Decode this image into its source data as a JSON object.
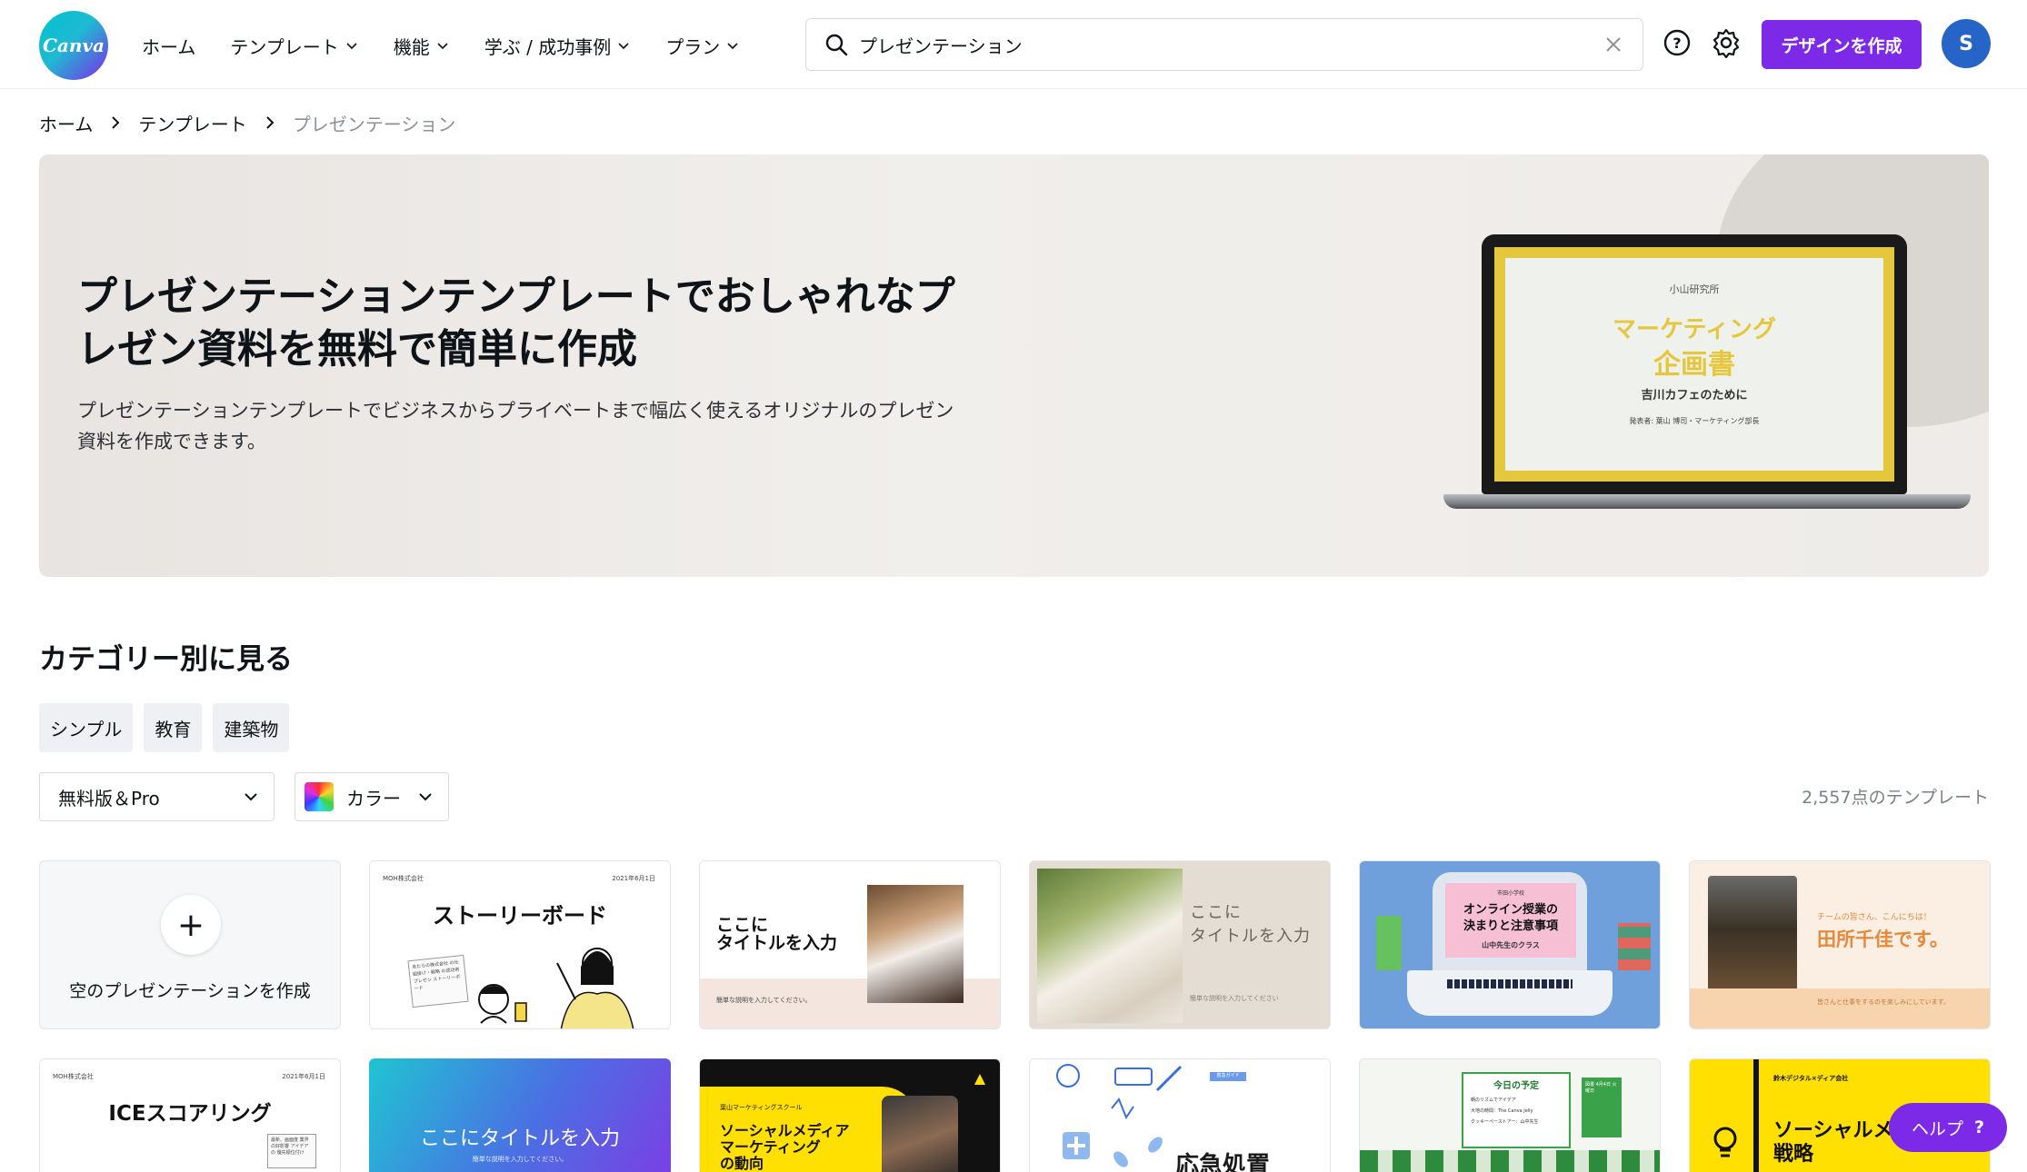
{
  "header": {
    "logo_text": "Canva",
    "nav": [
      {
        "label": "ホーム",
        "has_menu": false
      },
      {
        "label": "テンプレート",
        "has_menu": true
      },
      {
        "label": "機能",
        "has_menu": true
      },
      {
        "label": "学ぶ / 成功事例",
        "has_menu": true
      },
      {
        "label": "プラン",
        "has_menu": true
      }
    ],
    "search": {
      "value": "プレゼンテーション",
      "icon": "search-icon",
      "clear_icon": "close-icon"
    },
    "help_icon": "question-circle-icon",
    "settings_icon": "gear-icon",
    "create_button": "デザインを作成",
    "avatar_initial": "S",
    "accent_color": "#7d2ae8"
  },
  "breadcrumb": [
    "ホーム",
    "テンプレート",
    "プレゼンテーション"
  ],
  "hero": {
    "title": "プレゼンテーションテンプレートでおしゃれなプレゼン資料を無料で簡単に作成",
    "description": "プレゼンテーションテンプレートでビジネスからプライベートまで幅広く使えるオリジナルのプレゼン資料を作成できます。",
    "preview_slide": {
      "org": "小山研究所",
      "title_line1": "マーケティング",
      "title_line2": "企画書",
      "subtitle": "吉川カフェのために",
      "presenter": "発表者: 葉山 博司・マーケティング部長"
    }
  },
  "categories": {
    "heading": "カテゴリー別に見る",
    "chips": [
      "シンプル",
      "教育",
      "建築物"
    ]
  },
  "filters": {
    "license": "無料版＆Pro",
    "color": "カラー",
    "count": "2,557点のテンプレート"
  },
  "templates": {
    "blank_label": "空のプレゼンテーションを作成",
    "row1": [
      {
        "top_left": "MOH株式会社",
        "top_right": "2021年6月1日",
        "title": "ストーリーボード",
        "note": "あたらの株式会社 の仕組掛け・戦略 の成功例プレゼン ストーリーボード"
      },
      {
        "title": "ここに\nタイトルを入力",
        "footer": "簡単な説明を入力してください。"
      },
      {
        "title": "ここに\nタイトルを入力",
        "footer": "簡単な説明を入力してください"
      },
      {
        "school": "市田小学校",
        "title": "オンライン授業の\n決まりと注意事項",
        "teacher": "山中先生のクラス"
      },
      {
        "greeting": "チームの皆さん、こんにちは！",
        "title": "田所千佳です。",
        "footer": "皆さんと仕事をするのを楽しみにしています。"
      }
    ],
    "row2": [
      {
        "top_left": "MOH株式会社",
        "top_right": "2021年6月1日",
        "title": "ICEスコアリング",
        "note": "最新、画面度 業界の好影響 アイデアの 優先順位付け"
      },
      {
        "title": "ここにタイトルを入力",
        "footer": "簡単な説明を入力してください。"
      },
      {
        "org": "葉山マーケティングスクール",
        "title": "ソーシャルメディア\nマーケティング\nの動向"
      },
      {
        "badge": "救急ガイド",
        "title": "応急処置"
      },
      {
        "title": "今日の予定",
        "items": [
          "朝のリズムでアイデア",
          "大地の時間：The Canva Jelly",
          "クッキーペーストアー：山中先生"
        ],
        "label": "図書 4月4日 火曜日"
      },
      {
        "org": "鈴木デジタル×ディア会社",
        "title": "ソーシャルメ\n戦略"
      }
    ]
  },
  "help_button": {
    "label": "ヘルプ",
    "icon": "?"
  }
}
